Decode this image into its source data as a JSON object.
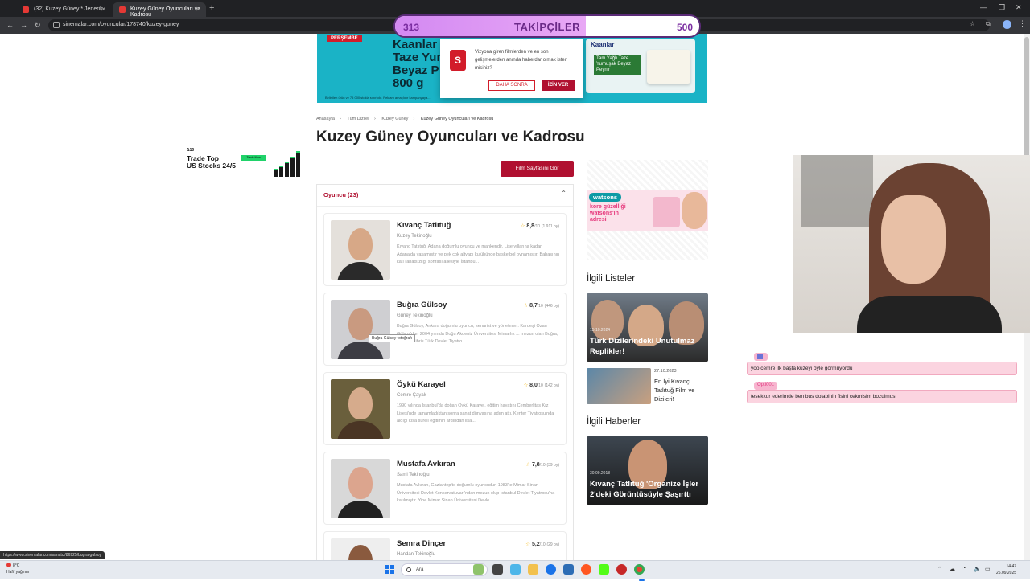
{
  "browser": {
    "tabs": [
      {
        "label": "(32) Kuzey Güney * Jenerik"
      },
      {
        "label": "Kuzey Güney Oyuncuları ve Kadrosu"
      }
    ],
    "url": "sinemalar.com/oyuncular/178740/kuzey-guney",
    "status_url": "https://www.sinemalar.com/sanatci/86925/bugra-gulsoy"
  },
  "follower_goal": {
    "current": "313",
    "label": "TAKİPÇİLER",
    "goal": "500",
    "progress": 0.626,
    "fill_color": "#d389f2"
  },
  "ad_banner": {
    "tag": "PERŞEMBE",
    "text": "Kaanlar\nTaze Yun\nBeyaz P\n800 g",
    "fine_print": "Belirtilen ürün ve 75 000 stokla sınırlıdır. Reklam amaçlıdır kampanyaya...",
    "brand": "Kaanlar",
    "product_text": "Tam Yağlı Taze Yumuşak Beyaz Peynir"
  },
  "notification": {
    "logo": "S",
    "text": "Vizyona giren filmlerden ve en son gelişmelerden anında haberdar olmak ister misiniz?",
    "later": "DAHA SONRA",
    "allow": "İZİN VER"
  },
  "breadcrumb": [
    "Anasayfa",
    "Tüm Diziler",
    "Kuzey Güney",
    "Kuzey Güney Oyuncuları ve Kadrosu"
  ],
  "page_title": "Kuzey Güney Oyuncuları ve Kadrosu",
  "side_ad": {
    "logo": "Δ10",
    "text": "Trade Top\nUS Stocks 24/5",
    "button": "Trade Now"
  },
  "film_button": "Film Sayfasını Gör",
  "cast": {
    "header": "Oyuncu (23)",
    "items": [
      {
        "name": "Kıvanç Tatlıtuğ",
        "role": "Kuzey Tekinoğlu",
        "bio": "Kıvanç Tatlıtuğ, Adana doğumlu oyuncu ve mankendir. Lise yıllarına kadar Adana'da yaşamıştır ve pek çok altyapı kulübünde basketbol oynamıştır. Babasının katı rahatsızlığı sonrası ailesiyle İstanbu...",
        "score": "8,8",
        "out_of": "/10",
        "votes": "(1.911 oy)"
      },
      {
        "name": "Buğra Gülsoy",
        "role": "Güney Tekinoğlu",
        "bio": "Buğra Gülsoy, Ankara doğumlu oyuncu, senarist ve yönetmen. Kardeşi Ozan Gülsoy'dur. 2004 yılında Doğu Akdeniz Üniversitesi Mimarlık ... mezun olan Buğra, bir süre Kibris Türk Devlet Tiyatro...",
        "score": "8,7",
        "out_of": "/10",
        "votes": "(446 oy)"
      },
      {
        "name": "Öykü Karayel",
        "role": "Cemre Çayak",
        "bio": "1990 yılında İstanbul'da doğan Öykü Karayel, eğitim hayatını Çemberlitaş Kız Lisesi'nde tamamladıktan sonra sanat dünyasına adım attı. Kenter Tiyatrosu'nda aldığı kısa süreli eğitimin ardından lisa...",
        "score": "8,0",
        "out_of": "/10",
        "votes": "(142 oy)"
      },
      {
        "name": "Mustafa Avkıran",
        "role": "Sami Tekinoğlu",
        "bio": "Mustafa Avkıran, Gaziantep'te doğumlu oyuncudur. 1983'te Mimar Sinan Üniversitesi Devlet Konservatuvarı'ndan mezun olup İstanbul Devlet Tiyatrosu'na katılmıştır. Yine Mimar Sinan Üniversitesi Devle...",
        "score": "7,8",
        "out_of": "/10",
        "votes": "(39 oy)"
      },
      {
        "name": "Semra Dinçer",
        "role": "Handan Tekinoğlu",
        "bio": "",
        "score": "5,2",
        "out_of": "/10",
        "votes": "(29 oy)"
      }
    ],
    "photo_tooltip": "Buğra Gülsoy fotoğrafı"
  },
  "right_ad": {
    "logo": "watsons",
    "text": "kore güzelliği\nwatsons'ın\nadresi"
  },
  "related_lists": {
    "heading": "İlgili Listeler",
    "featured": {
      "date": "15.10.2024",
      "title": "Türk Dizilerindeki Unutulmaz Replikler!"
    },
    "small": {
      "date": "27.10.2023",
      "title": "En İyi Kıvanç Tatlıtuğ Film ve Dizileri!"
    }
  },
  "related_news": {
    "heading": "İlgili Haberler",
    "featured": {
      "date": "30.09.2018",
      "title": "Kıvanç Tatlıtuğ 'Organize İşler 2'deki Görüntüsüyle Şaşırttı"
    }
  },
  "chat": [
    {
      "user": "",
      "message": "yoo cemre ilk başta kuzeyi öyle görmüyordu"
    },
    {
      "user": "Opti001",
      "message": "tesekkur ederimde ben bus dolabinin fisini cekmisim bozulmus"
    }
  ],
  "taskbar": {
    "weather_temp": "8°C",
    "weather_desc": "Hafif yağmur",
    "search": "Ara",
    "time": "14:47",
    "date": "26.09.2025"
  }
}
